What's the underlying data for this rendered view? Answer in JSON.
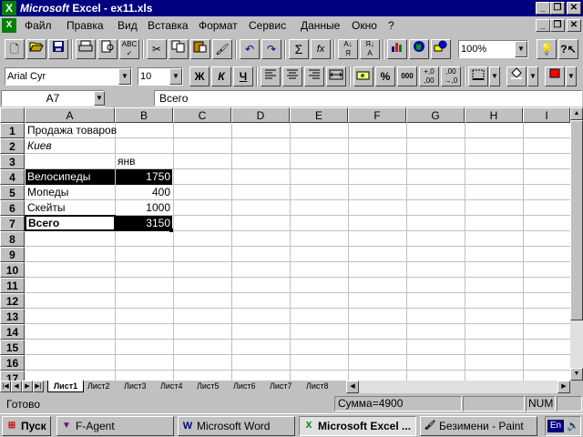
{
  "window": {
    "app_title": "Microsoft",
    "title_rest": "Excel - ex11.xls",
    "min": "_",
    "restore": "❐",
    "close": "✕"
  },
  "menu": [
    "Файл",
    "Правка",
    "Вид",
    "Вставка",
    "Формат",
    "Сервис",
    "Данные",
    "Окно",
    "?"
  ],
  "std_toolbar": {
    "zoom": "100%",
    "sum_glyph": "Σ",
    "fx_glyph": "fx"
  },
  "fmt_toolbar": {
    "font": "Arial Cyr",
    "size": "10",
    "bold": "Ж",
    "italic": "К",
    "underline": "Ч",
    "percent": "%",
    "thousands": "000"
  },
  "formula_bar": {
    "name_box": "A7",
    "content": "Всего"
  },
  "grid": {
    "columns": [
      "A",
      "B",
      "C",
      "D",
      "E",
      "F",
      "G",
      "H",
      "I"
    ],
    "rows": [
      "1",
      "2",
      "3",
      "4",
      "5",
      "6",
      "7",
      "8",
      "9",
      "10",
      "11",
      "12",
      "13",
      "14",
      "15",
      "16",
      "17"
    ],
    "cells": {
      "a1": "Продажа товаров",
      "a2": "Киев",
      "b3": "янв",
      "a4": "Велосипеды",
      "b4": "1750",
      "a5": "Мопеды",
      "b5": "400",
      "a6": "Скейты",
      "b6": "1000",
      "a7": "Всего",
      "b7": "3150"
    }
  },
  "sheets": [
    "Лист1",
    "Лист2",
    "Лист3",
    "Лист4",
    "Лист5",
    "Лист6",
    "Лист7",
    "Лист8"
  ],
  "status": {
    "ready": "Готово",
    "sum": "Сумма=4900",
    "num": "NUM"
  },
  "taskbar": {
    "start": "Пуск",
    "tasks": [
      "F-Agent",
      "Microsoft Word",
      "Microsoft Excel ...",
      "Безимени - Paint"
    ],
    "lang": "En"
  },
  "colors": {
    "title_bg": "#000080",
    "selection_bg": "#000000",
    "face": "#c0c0c0"
  }
}
